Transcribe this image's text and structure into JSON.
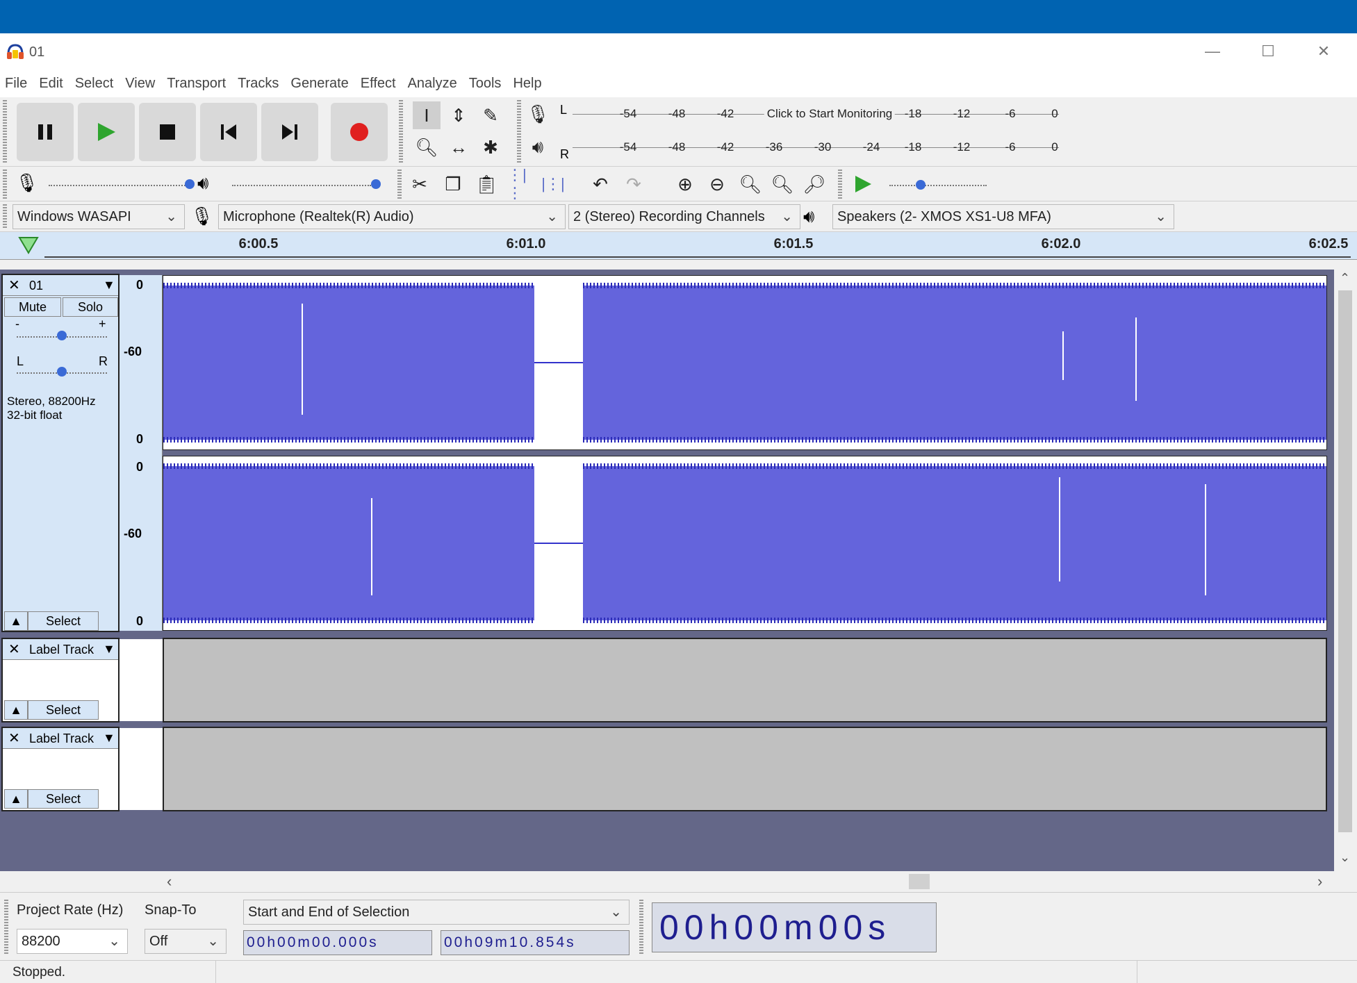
{
  "window": {
    "title": "01"
  },
  "menu": [
    "File",
    "Edit",
    "Select",
    "View",
    "Transport",
    "Tracks",
    "Generate",
    "Effect",
    "Analyze",
    "Tools",
    "Help"
  ],
  "meters": {
    "record_ticks": [
      "-54",
      "-48",
      "-42",
      "-18",
      "-12",
      "-6",
      "0"
    ],
    "record_prompt": "Click to Start Monitoring",
    "playback_ticks": [
      "-54",
      "-48",
      "-42",
      "-36",
      "-30",
      "-24",
      "-18",
      "-12",
      "-6",
      "0"
    ],
    "channel_l": "L",
    "channel_r": "R"
  },
  "device": {
    "host": "Windows WASAPI",
    "recording_device": "Microphone (Realtek(R) Audio)",
    "channels": "2 (Stereo) Recording Channels",
    "playback_device": "Speakers (2- XMOS XS1-U8 MFA)"
  },
  "ruler": {
    "labels": [
      "6:00.5",
      "6:01.0",
      "6:01.5",
      "6:02.0",
      "6:02.5"
    ]
  },
  "audio_track": {
    "name": "01",
    "mute": "Mute",
    "solo": "Solo",
    "gain_minus": "-",
    "gain_plus": "+",
    "pan_l": "L",
    "pan_r": "R",
    "info_line1": "Stereo, 88200Hz",
    "info_line2": "32-bit float",
    "select": "Select",
    "scale": {
      "top": "0",
      "mid": "-60",
      "bottom": "0"
    }
  },
  "label_tracks": [
    {
      "name": "Label Track",
      "select": "Select"
    },
    {
      "name": "Label Track",
      "select": "Select"
    }
  ],
  "bottom": {
    "project_rate_label": "Project Rate (Hz)",
    "snap_to_label": "Snap-To",
    "project_rate": "88200",
    "snap_to": "Off",
    "selection_mode": "Start and End of Selection",
    "start_time": "00h00m00.000s",
    "end_time": "00h09m10.854s",
    "audio_position": "00h00m00s"
  },
  "status": {
    "text": "Stopped."
  }
}
